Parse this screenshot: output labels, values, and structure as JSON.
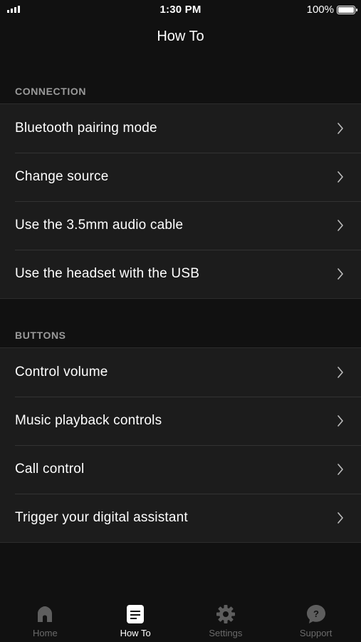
{
  "status_bar": {
    "time": "1:30 PM",
    "battery_percent": "100%",
    "battery_level": 1.0,
    "signal_bars": 4
  },
  "header": {
    "title": "How To"
  },
  "sections": [
    {
      "title": "CONNECTION",
      "items": [
        {
          "label": "Bluetooth pairing mode"
        },
        {
          "label": "Change source"
        },
        {
          "label": "Use the 3.5mm audio cable"
        },
        {
          "label": "Use the headset with the USB"
        }
      ]
    },
    {
      "title": "BUTTONS",
      "items": [
        {
          "label": "Control volume"
        },
        {
          "label": "Music playback controls"
        },
        {
          "label": "Call control"
        },
        {
          "label": "Trigger your digital assistant"
        }
      ]
    }
  ],
  "tab_bar": {
    "tabs": [
      {
        "label": "Home",
        "icon": "home-icon",
        "active": false
      },
      {
        "label": "How To",
        "icon": "document-icon",
        "active": true
      },
      {
        "label": "Settings",
        "icon": "gear-icon",
        "active": false
      },
      {
        "label": "Support",
        "icon": "question-bubble-icon",
        "active": false
      }
    ]
  },
  "colors": {
    "background": "#111111",
    "row_background": "#1c1c1c",
    "section_header": "#9a9a9a",
    "inactive_tab": "#6a6a6a",
    "active_tab": "#ffffff"
  }
}
